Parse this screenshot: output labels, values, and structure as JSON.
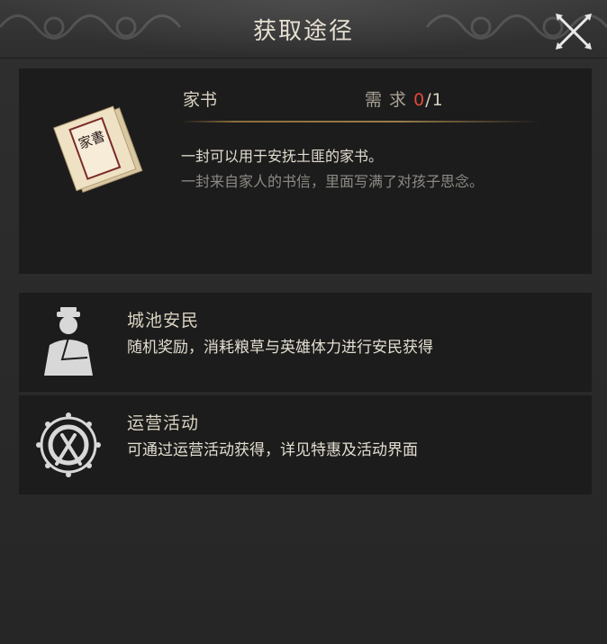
{
  "dialog": {
    "title": "获取途径"
  },
  "item": {
    "name": "家书",
    "requirement_label": "需 求",
    "requirement_current": "0",
    "requirement_total": "/1",
    "description": "一封可以用于安抚土匪的家书。",
    "flavor_text": "一封来自家人的书信，里面写满了对孩子思念。",
    "icon": "letter-scroll-icon",
    "icon_text": "家書"
  },
  "sources": [
    {
      "name": "城池安民",
      "description": "随机奖励，消耗粮草与英雄体力进行安民获得",
      "icon": "official-figure-icon"
    },
    {
      "name": "运营活动",
      "description": "可通过运营活动获得，详见特惠及活动界面",
      "icon": "war-drum-icon"
    }
  ],
  "colors": {
    "accent_red": "#e04a3a",
    "divider_gold": "#8a6c3c",
    "text_primary": "#e3ddd0",
    "text_muted": "#8d8a84"
  }
}
